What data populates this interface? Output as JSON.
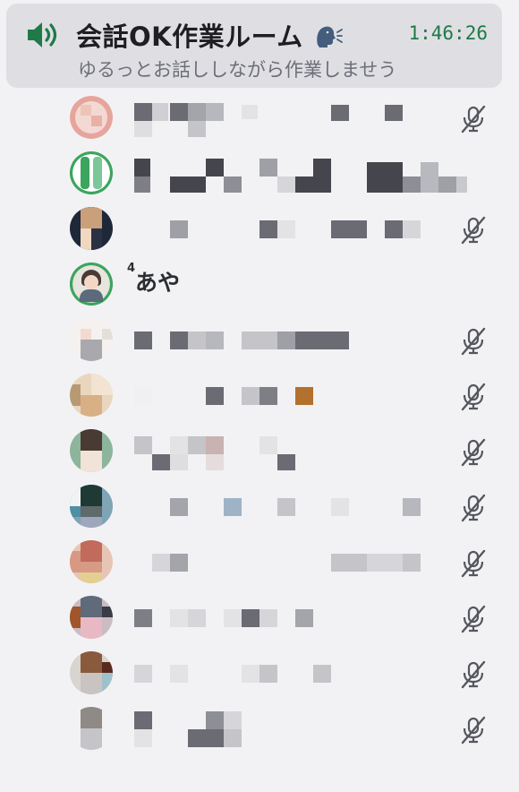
{
  "channel": {
    "icon": "speaker-icon",
    "status_icon": "speaking-head-icon",
    "name": "会話OK作業ルーム",
    "timer": "1:46:26",
    "topic": "ゆるっとお話ししながら作業しませう",
    "accent": "#1e7a47"
  },
  "members": [
    {
      "id": "m1",
      "muted": true,
      "speaking": false,
      "visible_name": null
    },
    {
      "id": "m2",
      "muted": false,
      "speaking": true,
      "visible_name": null
    },
    {
      "id": "m3",
      "muted": true,
      "speaking": false,
      "visible_name": null
    },
    {
      "id": "m4",
      "muted": false,
      "speaking": true,
      "visible_name": {
        "prefix": "4",
        "text": "あや"
      }
    },
    {
      "id": "m5",
      "muted": true,
      "speaking": false,
      "visible_name": null
    },
    {
      "id": "m6",
      "muted": true,
      "speaking": false,
      "visible_name": null
    },
    {
      "id": "m7",
      "muted": true,
      "speaking": false,
      "visible_name": null
    },
    {
      "id": "m8",
      "muted": true,
      "speaking": false,
      "visible_name": null
    },
    {
      "id": "m9",
      "muted": true,
      "speaking": false,
      "visible_name": null
    },
    {
      "id": "m10",
      "muted": true,
      "speaking": false,
      "visible_name": null
    },
    {
      "id": "m11",
      "muted": true,
      "speaking": false,
      "visible_name": null
    },
    {
      "id": "m12",
      "muted": true,
      "speaking": false,
      "visible_name": null
    }
  ],
  "colors": {
    "background": "#f2f2f4",
    "card": "#dfdfe3",
    "speaking_ring": "#3ba55d",
    "muted_icon": "#55575e"
  }
}
